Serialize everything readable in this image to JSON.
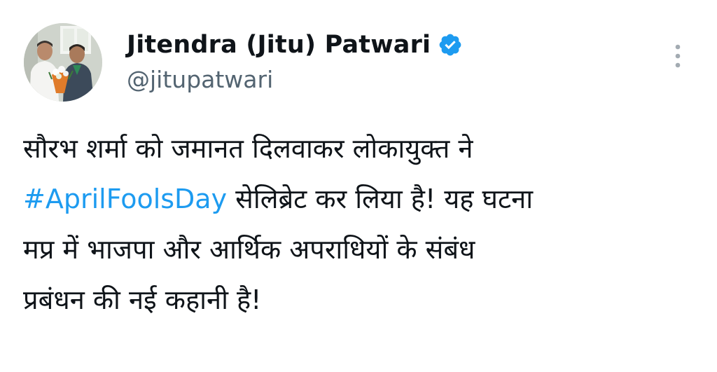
{
  "author": {
    "display_name": "Jitendra (Jitu) Patwari",
    "handle": "@jitupatwari",
    "verified": true,
    "verified_badge_icon": "verified-badge-icon",
    "avatar_icon": "profile-photo"
  },
  "menu": {
    "more_icon": "more-vertical-icon"
  },
  "tweet": {
    "line1": "सौरभ शर्मा को जमानत दिलवाकर लोकायुक्त ने",
    "hashtag": "#AprilFoolsDay",
    "line2_rest": " सेलिब्रेट कर लिया है! यह घटना",
    "line3": "मप्र में भाजपा और आर्थिक अपराधियों के संबंध",
    "line4": "प्रबंधन की नई कहानी है!"
  },
  "colors": {
    "text": "#0f1419",
    "secondary_text": "#536471",
    "link": "#1d9bf0",
    "verified_badge": "#1d9bf0",
    "background": "#ffffff"
  }
}
